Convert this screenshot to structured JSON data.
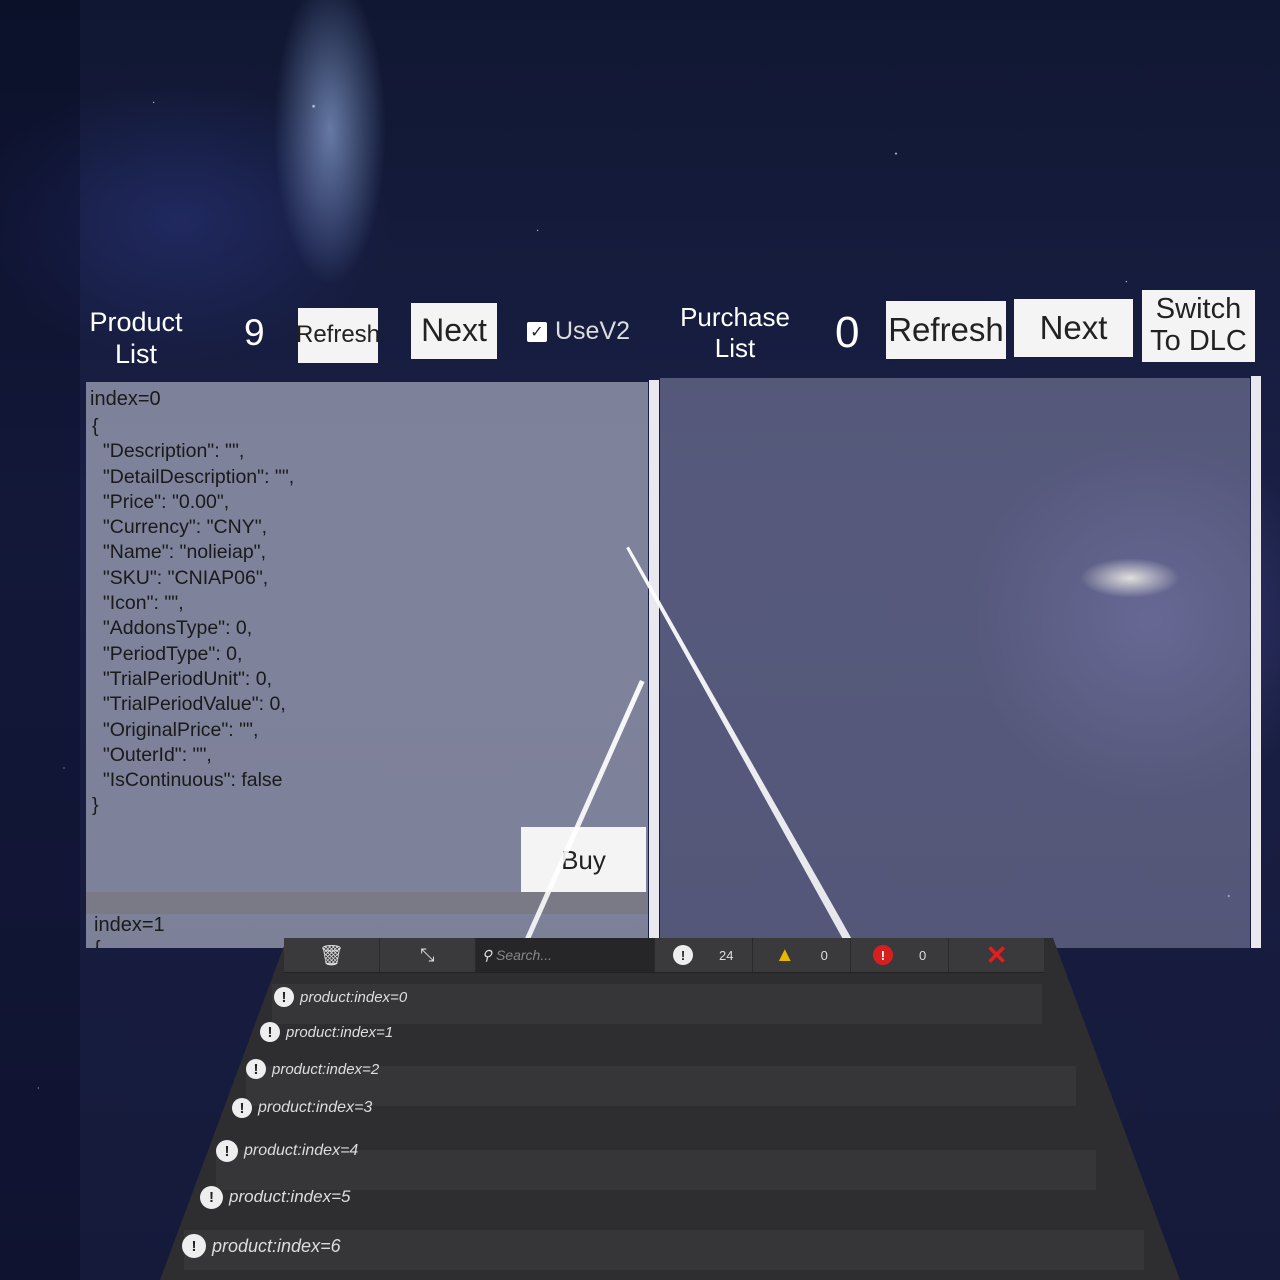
{
  "product": {
    "label": "Product\nList",
    "count": "9",
    "refresh_label": "Refresh",
    "next_label": "Next",
    "usev2_label": "UseV2",
    "usev2_checked": true,
    "items": [
      {
        "header": "index=0",
        "json": "{\n  \"Description\": \"\",\n  \"DetailDescription\": \"\",\n  \"Price\": \"0.00\",\n  \"Currency\": \"CNY\",\n  \"Name\": \"nolieiap\",\n  \"SKU\": \"CNIAP06\",\n  \"Icon\": \"\",\n  \"AddonsType\": 0,\n  \"PeriodType\": 0,\n  \"TrialPeriodUnit\": 0,\n  \"TrialPeriodValue\": 0,\n  \"OriginalPrice\": \"\",\n  \"OuterId\": \"\",\n  \"IsContinuous\": false\n}"
      },
      {
        "header": "index=1",
        "json": "{"
      }
    ],
    "buy_label": "Buy"
  },
  "purchase": {
    "label": "Purchase\nList",
    "count": "0",
    "refresh_label": "Refresh",
    "next_label": "Next",
    "switch_label": "Switch\nTo DLC"
  },
  "console": {
    "search_placeholder": "Search...",
    "info_count": "24",
    "warning_count": "0",
    "error_count": "0",
    "logs": [
      "product:index=0",
      "product:index=1",
      "product:index=2",
      "product:index=3",
      "product:index=4",
      "product:index=5",
      "product:index=6"
    ],
    "icons": {
      "clear": "trash-icon",
      "collapse": "collapse-icon",
      "search": "search-icon",
      "info": "info-icon",
      "warning": "warning-icon",
      "error": "error-icon",
      "close": "close-icon"
    }
  },
  "colors": {
    "warning": "#e6b800",
    "error": "#d62020",
    "close": "#e02020"
  }
}
